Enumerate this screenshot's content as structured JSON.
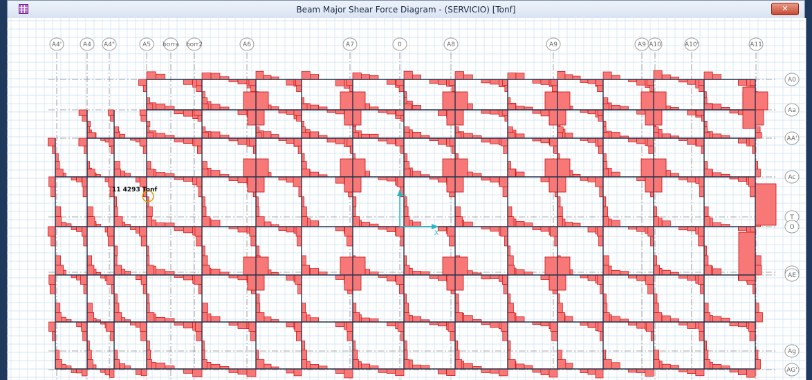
{
  "window": {
    "title": "Beam Major Shear Force Diagram - (SERVICIO)  [Tonf]",
    "close_glyph": "✕"
  },
  "axes_top": [
    {
      "label": "A4'"
    },
    {
      "label": "A4"
    },
    {
      "label": "A4\""
    },
    {
      "label": "A5"
    },
    {
      "label": "borra"
    },
    {
      "label": "borr2"
    },
    {
      "label": "A6"
    },
    {
      "label": "A7"
    },
    {
      "label": "0"
    },
    {
      "label": "A8"
    },
    {
      "label": "A9"
    },
    {
      "label": "A9"
    },
    {
      "label": "A10"
    },
    {
      "label": "A10'"
    },
    {
      "label": "A11"
    }
  ],
  "axes_right": [
    {
      "label": "A0"
    },
    {
      "label": "Aa"
    },
    {
      "label": "AA'"
    },
    {
      "label": "Ac"
    },
    {
      "label": "T"
    },
    {
      "label": "O"
    },
    {
      "label": "AC"
    },
    {
      "label": "AE"
    },
    {
      "label": "Ag"
    },
    {
      "label": "AG'"
    }
  ],
  "annotation": {
    "text": "11 4293 Tonf"
  },
  "origin_axes": {
    "x": "X",
    "y": "Y"
  },
  "colors": {
    "diagram_fill": "#f87878",
    "diagram_stroke": "#c21010",
    "beam": "#23324a",
    "grid": "#c9dff0",
    "axis_line": "#8c8c8c",
    "bubble": "#9a9a9a",
    "origin": "#27b7c4",
    "titlebar": "#dde6f2"
  }
}
